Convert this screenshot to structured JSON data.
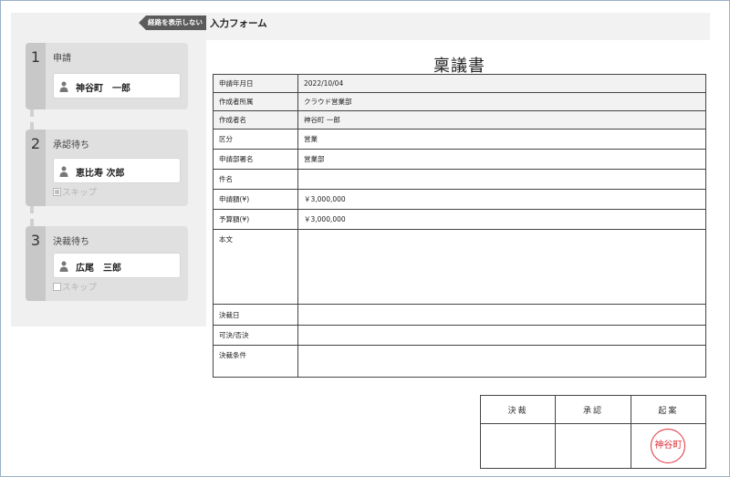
{
  "route": {
    "hide_button": "経路を表示しない",
    "steps": [
      {
        "number": "1",
        "title": "申請",
        "user": "神谷町　一郎"
      },
      {
        "number": "2",
        "title": "承認待ち",
        "user": "恵比寿 次郎",
        "skip": "スキップ"
      },
      {
        "number": "3",
        "title": "決裁待ち",
        "user": "広尾　三郎",
        "skip": "スキップ"
      }
    ]
  },
  "form": {
    "header_title": "入力フォーム",
    "document_title": "稟議書",
    "rows": [
      {
        "label": "申請年月日",
        "value": "2022/10/04"
      },
      {
        "label": "作成者所属",
        "value": "クラウド営業部"
      },
      {
        "label": "作成者名",
        "value": "神谷町 一郎"
      },
      {
        "label": "区分",
        "value": "営業"
      },
      {
        "label": "申請部署名",
        "value": "営業部"
      },
      {
        "label": "件名",
        "value": ""
      },
      {
        "label": "申請額(¥)",
        "value": "￥3,000,000"
      },
      {
        "label": "予算額(¥)",
        "value": "￥3,000,000"
      },
      {
        "label": "本文",
        "value": ""
      },
      {
        "label": "決裁日",
        "value": ""
      },
      {
        "label": "可決/否決",
        "value": ""
      },
      {
        "label": "決裁条件",
        "value": ""
      }
    ],
    "stamp_headers": [
      "決裁",
      "承認",
      "起案"
    ],
    "hanko_text": "神谷町",
    "hanko_color": "#e0303a"
  }
}
